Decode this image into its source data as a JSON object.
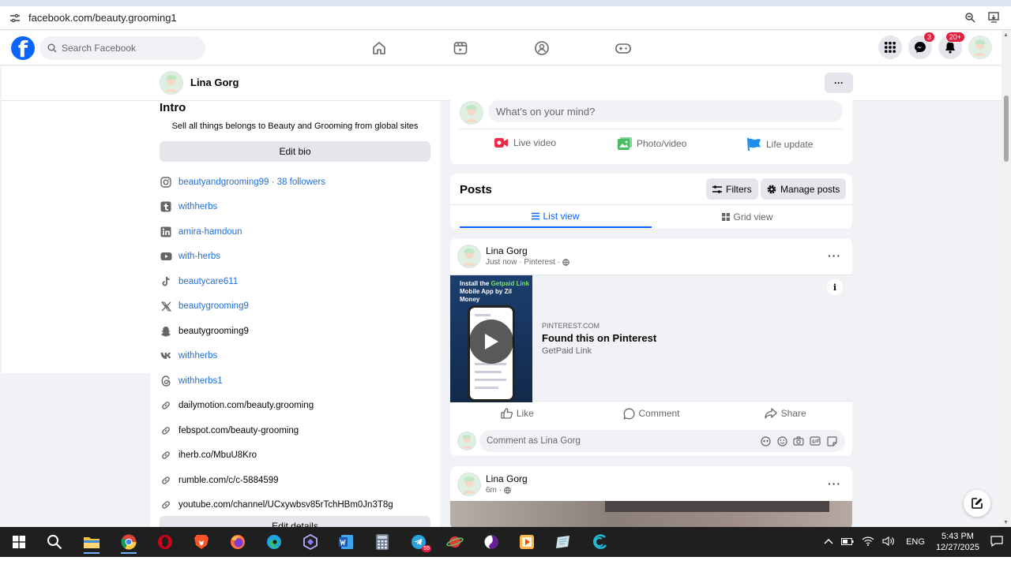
{
  "browser": {
    "url": "facebook.com/beauty.grooming1"
  },
  "header": {
    "search_placeholder": "Search Facebook",
    "messenger_badge": "3",
    "notifications_badge": "20+"
  },
  "profile": {
    "name": "Lina Gorg",
    "more": "···"
  },
  "intro": {
    "title": "Intro",
    "bio": "Sell all things belongs to Beauty and Grooming from global sites",
    "edit_bio": "Edit bio",
    "edit_details": "Edit details",
    "links": [
      {
        "icon": "instagram-icon",
        "text": "beautyandgrooming99 · 38 followers",
        "blue": true
      },
      {
        "icon": "tumblr-icon",
        "text": "withherbs",
        "blue": true
      },
      {
        "icon": "linkedin-icon",
        "text": "amira-hamdoun",
        "blue": true
      },
      {
        "icon": "youtube-icon",
        "text": "with-herbs",
        "blue": true
      },
      {
        "icon": "tiktok-icon",
        "text": "beautycare611",
        "blue": true
      },
      {
        "icon": "x-icon",
        "text": "beautygrooming9",
        "blue": true
      },
      {
        "icon": "snapchat-icon",
        "text": "beautygrooming9",
        "blue": false
      },
      {
        "icon": "vk-icon",
        "text": "withherbs",
        "blue": true
      },
      {
        "icon": "threads-icon",
        "text": "withherbs1",
        "blue": true
      },
      {
        "icon": "link-icon",
        "text": "dailymotion.com/beauty.grooming",
        "blue": false
      },
      {
        "icon": "link-icon",
        "text": "febspot.com/beauty-grooming",
        "blue": false
      },
      {
        "icon": "link-icon",
        "text": "iherb.co/MbuU8Kro",
        "blue": false
      },
      {
        "icon": "link-icon",
        "text": "rumble.com/c/c-5884599",
        "blue": false
      },
      {
        "icon": "link-icon",
        "text": "youtube.com/channel/UCxywbsv85rTchHBm0Jn3T8g",
        "blue": false
      }
    ]
  },
  "composer": {
    "placeholder": "What's on your mind?",
    "live_video": "Live video",
    "photo_video": "Photo/video",
    "life_update": "Life update"
  },
  "posts_header": {
    "title": "Posts",
    "filters": "Filters",
    "manage_posts": "Manage posts",
    "list_view": "List view",
    "grid_view": "Grid view"
  },
  "post1": {
    "author": "Lina Gorg",
    "meta": "Just now · Pinterest ·",
    "thumb_line1": "Install the",
    "thumb_highlight": "Getpaid Link",
    "thumb_line2": "Mobile App by Zil Money",
    "domain": "PINTEREST.COM",
    "title": "Found this on Pinterest",
    "subtitle": "GetPaid Link",
    "like": "Like",
    "comment": "Comment",
    "share": "Share",
    "comment_placeholder": "Comment as Lina Gorg"
  },
  "post2": {
    "author": "Lina Gorg",
    "meta": "6m ·"
  },
  "taskbar": {
    "lang": "ENG",
    "time": "5:43 PM",
    "date": "12/27/2025",
    "telegram_badge": "59"
  },
  "colors": {
    "fb_blue": "#0866ff",
    "link_blue": "#216fdb",
    "badge_red": "#e41e3f"
  }
}
